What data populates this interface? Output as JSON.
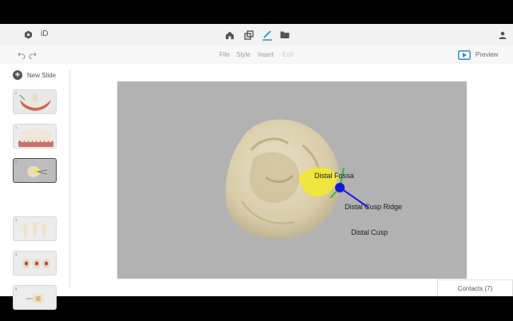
{
  "app": {
    "logo_text": "iD"
  },
  "toolbar": {
    "menus": [
      {
        "label": "File"
      },
      {
        "label": "Style"
      },
      {
        "label": "Insert"
      },
      {
        "label": "Edit"
      }
    ],
    "preview_label": "Preview"
  },
  "sidebar": {
    "new_slide_label": "New Slide",
    "slides": [
      {
        "number": "0"
      },
      {
        "number": "1"
      },
      {
        "number": "2"
      },
      {
        "number": "3"
      },
      {
        "number": "4"
      },
      {
        "number": "5"
      }
    ]
  },
  "viewport": {
    "labels": {
      "distal_fossa": "Distal Fossa",
      "distal_cusp_ridge": "Distal Cusp Ridge",
      "distal_cusp": "Distal Cusp"
    }
  },
  "footer": {
    "contacts_label": "Contacts (7)"
  },
  "colors": {
    "accent": "#2a8fd6",
    "canvas_bg": "#b2b2b2",
    "highlight": "#f2ea2a",
    "axis_blue": "#1a1ae0",
    "axis_green": "#1fc41f"
  },
  "icons": [
    "settings-icon",
    "home-icon",
    "layers-icon",
    "pen-icon",
    "folder-icon",
    "user-icon",
    "undo-icon",
    "redo-icon",
    "play-icon"
  ]
}
